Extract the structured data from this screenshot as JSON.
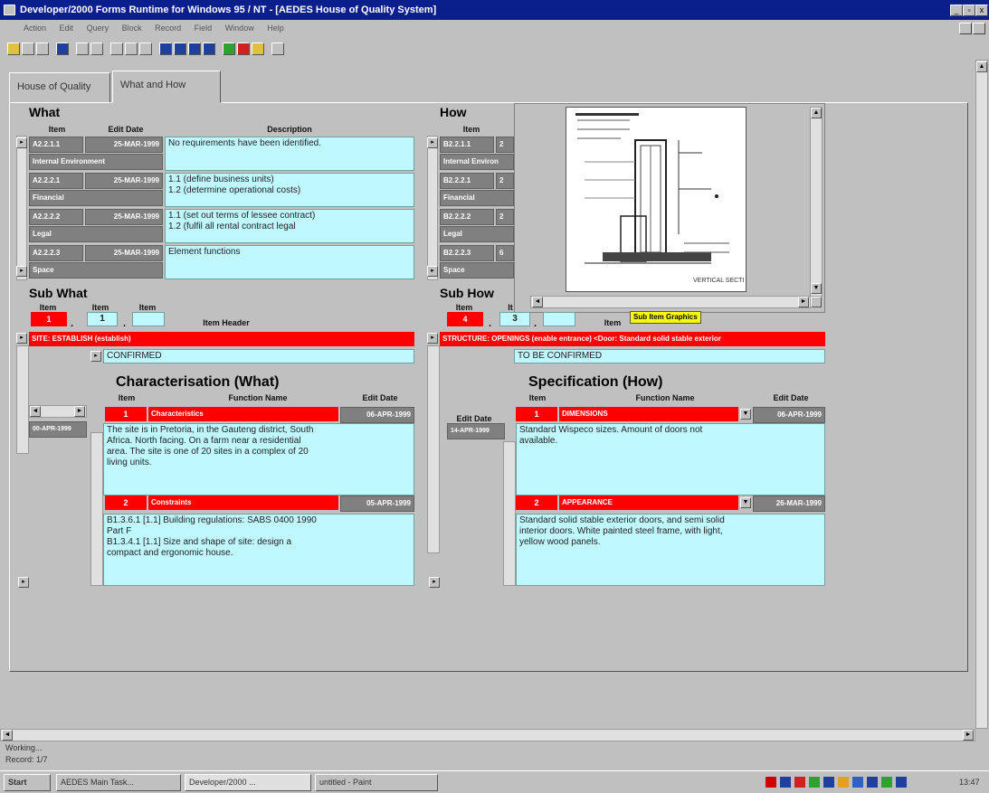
{
  "window": {
    "title": "Developer/2000 Forms Runtime for Windows 95 / NT - [AEDES House of Quality System]",
    "min_label": "_",
    "max_label": "▫",
    "close_label": "x"
  },
  "menu": [
    "Action",
    "Edit",
    "Query",
    "Block",
    "Record",
    "Field",
    "Window",
    "Help"
  ],
  "tabs": [
    "House of Quality",
    "What and How"
  ],
  "what": {
    "title": "What",
    "headers": {
      "item": "Item",
      "edit_date": "Edit Date",
      "description": "Description"
    },
    "rows": [
      {
        "item": "A2.2.1.1",
        "date": "25-MAR-1999",
        "group": "Internal Environment",
        "desc1": "No requirements have been identified.",
        "desc2": ""
      },
      {
        "item": "A2.2.2.1",
        "date": "25-MAR-1999",
        "group": "Financial",
        "desc1": "1.1 (define business units)",
        "desc2": "1.2 (determine operational costs)"
      },
      {
        "item": "A2.2.2.2",
        "date": "25-MAR-1999",
        "group": "Legal",
        "desc1": "1.1 (set out terms of lessee contract)",
        "desc2": "1.2 (fulfil all rental contract legal"
      },
      {
        "item": "A2.2.2.3",
        "date": "25-MAR-1999",
        "group": "Space",
        "desc1": "Element functions",
        "desc2": ""
      }
    ]
  },
  "how": {
    "title": "How",
    "headers": {
      "item": "Item"
    },
    "rows": [
      {
        "item": "B2.2.1.1",
        "date": "2",
        "group": "Internal Environ"
      },
      {
        "item": "B2.2.2.1",
        "date": "2",
        "group": "Financial"
      },
      {
        "item": "B2.2.2.2",
        "date": "2",
        "group": "Legal"
      },
      {
        "item": "B2.2.2.3",
        "date": "6",
        "group": "Space"
      }
    ]
  },
  "drawing": {
    "caption": "VERTICAL SECTI"
  },
  "sub_what": {
    "title": "Sub What",
    "headers": {
      "item1": "Item",
      "item2": "Item",
      "item3": "Item",
      "header": "Item Header"
    },
    "item1": "1",
    "item2": "1",
    "item3": "",
    "header_value": "SITE: ESTABLISH (establish)",
    "status": "CONFIRMED"
  },
  "sub_how": {
    "title": "Sub How",
    "headers": {
      "item1": "Item",
      "item2": "It",
      "item3": "",
      "item_label": "Item"
    },
    "item1": "4",
    "item2": "3",
    "item3": "",
    "graphics_button": "Sub Item Graphics",
    "header_value": "STRUCTURE: OPENINGS (enable entrance) <Door: Standard solid stable exterior",
    "status": "TO BE CONFIRMED"
  },
  "characterisation": {
    "title": "Characterisation (What)",
    "headers": {
      "item": "Item",
      "function_name": "Function Name",
      "edit_date": "Edit Date"
    },
    "side_date": "00-APR-1999",
    "rows": [
      {
        "item": "1",
        "name": "Characteristics",
        "date": "06-APR-1999",
        "lines": [
          "The site is in Pretoria, in the Gauteng district, South",
          "Africa. North facing. On a farm near a residential",
          "area. The site is one of 20 sites in a complex of 20",
          "living units."
        ]
      },
      {
        "item": "2",
        "name": "Constraints",
        "date": "05-APR-1999",
        "lines": [
          "B1.3.6.1 [1.1] Building regulations: SABS 0400 1990",
          "Part F",
          "B1.3.4.1 [1.1] Size and shape of site: design a",
          "compact and ergonomic house."
        ]
      }
    ]
  },
  "specification": {
    "title": "Specification (How)",
    "headers": {
      "item": "Item",
      "function_name": "Function Name",
      "edit_date": "Edit Date"
    },
    "side_label": "Edit Date",
    "side_date": "14-APR-1999",
    "rows": [
      {
        "item": "1",
        "name": "DIMENSIONS",
        "date": "06-APR-1999",
        "lines": [
          "Standard Wispeco sizes. Amount of doors not",
          "available."
        ]
      },
      {
        "item": "2",
        "name": "APPEARANCE",
        "date": "26-MAR-1999",
        "lines": [
          "Standard solid stable exterior doors, and semi solid",
          "interior doors. White painted steel frame, with light,",
          "yellow wood panels."
        ]
      }
    ]
  },
  "statusbar": {
    "line1": "Working...",
    "line2": "Record: 1/7"
  },
  "taskbar": {
    "start": "Start",
    "tasks": [
      "AEDES Main Task...",
      "Developer/2000 ...",
      "untitled - Paint"
    ],
    "clock": "13:47"
  },
  "colors": {
    "red": "#ff0000",
    "cyan": "#bff8ff",
    "gray": "#808080",
    "title": "#0a1e8c"
  }
}
